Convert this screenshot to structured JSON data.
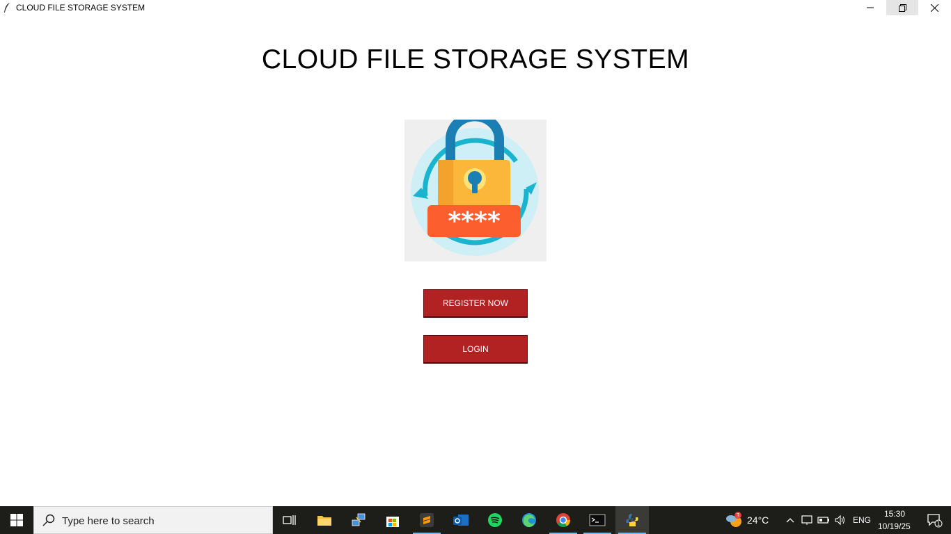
{
  "window": {
    "title": "CLOUD FILE STORAGE SYSTEM"
  },
  "main": {
    "heading": "CLOUD FILE STORAGE SYSTEM",
    "lock_masked_text": "****",
    "register_label": "REGISTER NOW",
    "login_label": "LOGIN"
  },
  "taskbar": {
    "search_placeholder": "Type here to search",
    "apps": [
      "task-view",
      "file-explorer",
      "network-app",
      "microsoft-store",
      "sublime-text",
      "outlook",
      "spotify",
      "edge",
      "chrome",
      "terminal",
      "python"
    ],
    "weather_badge": "3",
    "temperature": "24°C",
    "language": "ENG",
    "time": "15:30",
    "date": "10/19/25",
    "notification_count": "1"
  },
  "colors": {
    "button_bg": "#b22222",
    "taskbar_bg": "#1d1e1a"
  }
}
